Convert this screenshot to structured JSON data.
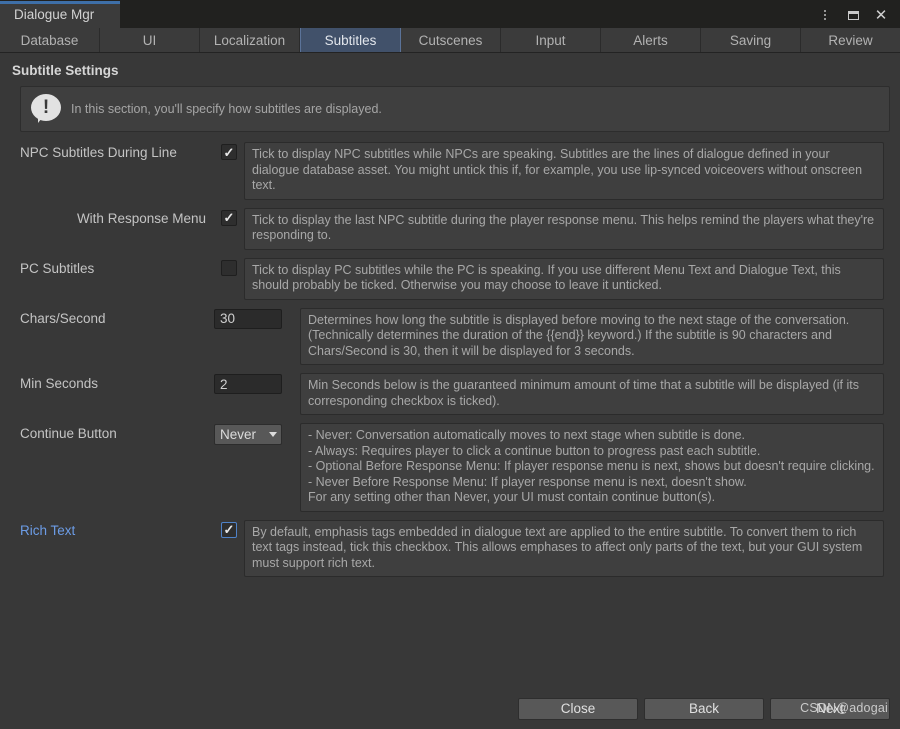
{
  "window": {
    "tab_title": "Dialogue Mgr",
    "accent_color": "#3e6fa8",
    "controls": {
      "menu": "⋮",
      "maximize": "",
      "close": "✕"
    }
  },
  "toolbar": {
    "tabs": [
      {
        "label": "Database",
        "active": false
      },
      {
        "label": "UI",
        "active": false
      },
      {
        "label": "Localization",
        "active": false
      },
      {
        "label": "Subtitles",
        "active": true
      },
      {
        "label": "Cutscenes",
        "active": false
      },
      {
        "label": "Input",
        "active": false
      },
      {
        "label": "Alerts",
        "active": false
      },
      {
        "label": "Saving",
        "active": false
      },
      {
        "label": "Review",
        "active": false
      }
    ]
  },
  "main": {
    "section_title": "Subtitle Settings",
    "info_box": {
      "icon": "info-exclamation-icon",
      "text": "In this section, you'll specify how subtitles are displayed."
    },
    "fields": {
      "npc_subtitles_during_line": {
        "label": "NPC Subtitles During Line",
        "checked": true,
        "help": "Tick to display NPC subtitles while NPCs are speaking. Subtitles are the lines of dialogue defined in your dialogue database asset. You might untick this if, for example, you use lip-synced voiceovers without onscreen text."
      },
      "with_response_menu": {
        "label": "With Response Menu",
        "checked": true,
        "help": "Tick to display the last NPC subtitle during the player response menu. This helps remind the players what they're responding to."
      },
      "pc_subtitles": {
        "label": "PC Subtitles",
        "checked": false,
        "help": "Tick to display PC subtitles while the PC is speaking. If you use different Menu Text and Dialogue Text, this should probably be ticked. Otherwise you may choose to leave it unticked."
      },
      "chars_per_second": {
        "label": "Chars/Second",
        "value": "30",
        "help": "Determines how long the subtitle is displayed before moving to the next stage of the conversation. (Technically determines the duration of the {{end}} keyword.) If the subtitle is 90 characters and Chars/Second is 30, then it will be displayed for 3 seconds."
      },
      "min_seconds": {
        "label": "Min Seconds",
        "value": "2",
        "help": "Min Seconds below is the guaranteed minimum amount of time that a subtitle will be displayed (if its corresponding checkbox is ticked)."
      },
      "continue_button": {
        "label": "Continue Button",
        "value": "Never",
        "options": [
          "Never",
          "Always",
          "Optional Before Response Menu",
          "Never Before Response Menu"
        ],
        "help_lines": [
          "- Never: Conversation automatically moves to next stage when subtitle is done.",
          "- Always: Requires player to click a continue button to progress past each subtitle.",
          "- Optional Before Response Menu: If player response menu is next, shows but doesn't require clicking.",
          "- Never Before Response Menu: If player response menu is next, doesn't show.",
          "For any setting other than Never, your UI must contain continue button(s)."
        ]
      },
      "rich_text": {
        "label": "Rich Text",
        "checked": true,
        "highlight_color": "#6c9ce6",
        "help": "By default, emphasis tags embedded in dialogue text are applied to the entire subtitle. To convert them to rich text tags instead, tick this checkbox. This allows emphases to affect only parts of the text, but your GUI system must support rich text."
      }
    }
  },
  "footer": {
    "buttons": [
      {
        "label": "Close"
      },
      {
        "label": "Back"
      },
      {
        "label": "Next"
      }
    ],
    "watermark": "CSDN@adogai"
  }
}
